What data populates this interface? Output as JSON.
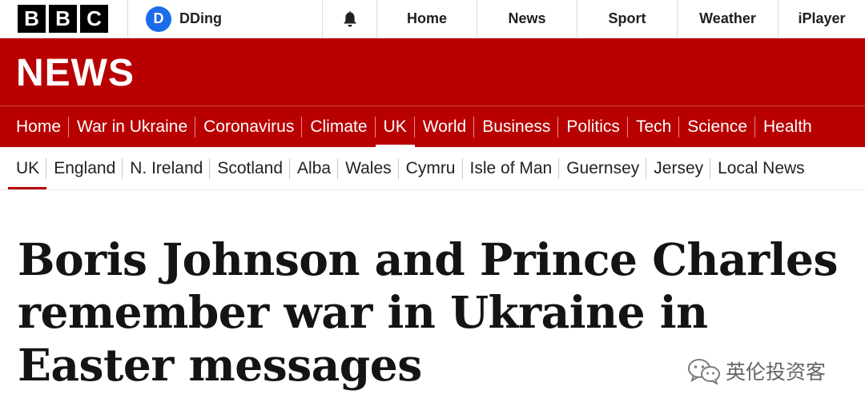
{
  "top_bar": {
    "logo_letters": [
      "B",
      "B",
      "C"
    ],
    "account": {
      "initial": "D",
      "name": "DDing"
    },
    "notifications_icon": "bell-icon",
    "nav": [
      "Home",
      "News",
      "Sport",
      "Weather",
      "iPlayer"
    ]
  },
  "banner": {
    "title": "NEWS"
  },
  "section_nav": {
    "items": [
      "Home",
      "War in Ukraine",
      "Coronavirus",
      "Climate",
      "UK",
      "World",
      "Business",
      "Politics",
      "Tech",
      "Science",
      "Health"
    ],
    "active": "UK"
  },
  "sub_nav": {
    "items": [
      "UK",
      "England",
      "N. Ireland",
      "Scotland",
      "Alba",
      "Wales",
      "Cymru",
      "Isle of Man",
      "Guernsey",
      "Jersey",
      "Local News"
    ],
    "active": "UK"
  },
  "article": {
    "headline": "Boris Johnson and Prince Charles remember war in Ukraine in Easter messages"
  },
  "watermark": {
    "text": "英伦投资客",
    "icon": "wechat-icon"
  },
  "colors": {
    "brand_red": "#b80000",
    "avatar_blue": "#1a6ce8"
  }
}
